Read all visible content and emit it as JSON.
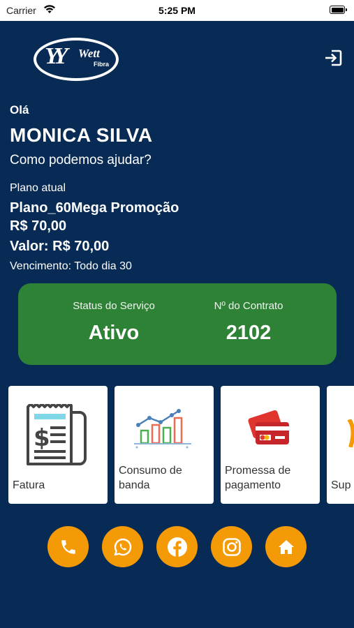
{
  "status_bar": {
    "carrier": "Carrier",
    "time": "5:25 PM"
  },
  "header": {
    "logo_text": "Wett",
    "logo_sub": "Fibra",
    "logout_icon": "logout-icon"
  },
  "greeting": {
    "hello": "Olá",
    "user_name": "MONICA SILVA",
    "prompt": "Como podemos ajudar?"
  },
  "plan": {
    "label": "Plano atual",
    "name": "Plano_60Mega Promoção",
    "price": "R$ 70,00",
    "value": "Valor: R$ 70,00",
    "due": "Vencimento: Todo dia 30"
  },
  "service_status": {
    "status_label": "Status do Serviço",
    "status_value": "Ativo",
    "contract_label": "Nº do Contrato",
    "contract_value": "2102"
  },
  "tiles": [
    {
      "label": "Fatura",
      "icon": "invoice-icon"
    },
    {
      "label": "Consumo de banda",
      "icon": "bandwidth-chart-icon"
    },
    {
      "label": "Promessa de pagamento",
      "icon": "credit-card-icon"
    },
    {
      "label": "Sup",
      "icon": "support-icon"
    }
  ],
  "bottom_buttons": [
    {
      "icon": "phone-icon"
    },
    {
      "icon": "whatsapp-icon"
    },
    {
      "icon": "facebook-icon"
    },
    {
      "icon": "instagram-icon"
    },
    {
      "icon": "home-icon"
    }
  ],
  "colors": {
    "background": "#072b55",
    "status_card": "#2e8235",
    "accent_orange": "#f59a07",
    "tile_background": "#ffffff"
  }
}
